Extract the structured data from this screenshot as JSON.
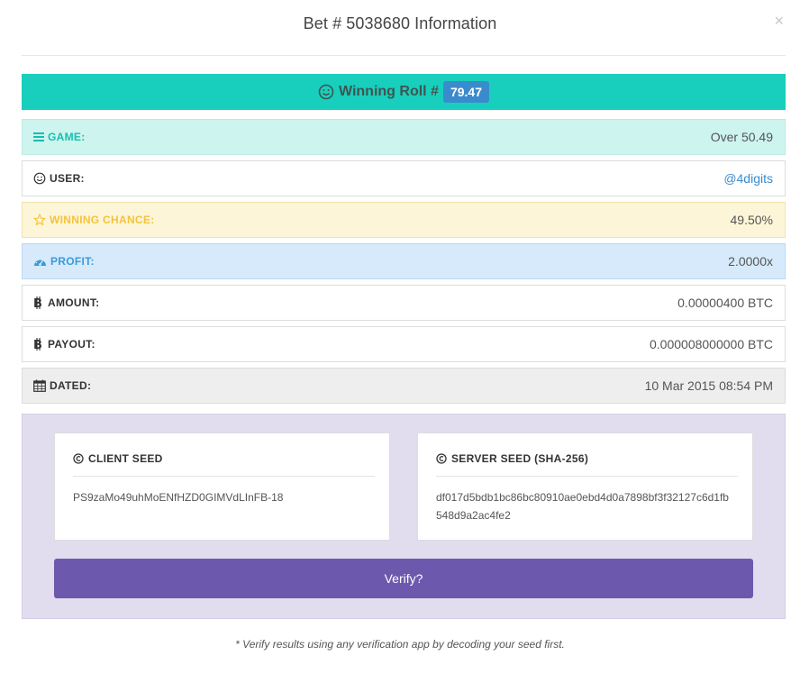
{
  "modal": {
    "title": "Bet # 5038680 Information",
    "close_label": "×"
  },
  "banner": {
    "label": "Winning Roll #",
    "roll": "79.47",
    "icon": "smile-icon"
  },
  "rows": {
    "game": {
      "label": "GAME:",
      "value": "Over 50.49",
      "icon": "bars-icon"
    },
    "user": {
      "label": "USER:",
      "value": "@4digits",
      "icon": "smile-icon"
    },
    "chance": {
      "label": "WINNING CHANCE:",
      "value": "49.50%",
      "icon": "star-icon"
    },
    "profit": {
      "label": "PROFIT:",
      "value": "2.0000x",
      "icon": "dashboard-icon"
    },
    "amount": {
      "label": "AMOUNT:",
      "value": "0.00000400 BTC",
      "icon": "bitcoin-icon"
    },
    "payout": {
      "label": "PAYOUT:",
      "value": "0.000008000000 BTC",
      "icon": "bitcoin-icon"
    },
    "dated": {
      "label": "DATED:",
      "value": "10 Mar 2015 08:54 PM",
      "icon": "calendar-icon"
    }
  },
  "seeds": {
    "client": {
      "heading": "CLIENT SEED",
      "value": "PS9zaMo49uhMoENfHZD0GIMVdLInFB-18"
    },
    "server": {
      "heading": "SERVER SEED (SHA-256)",
      "value": "df017d5bdb1bc86bc80910ae0ebd4d0a7898bf3f32127c6d1fb548d9a2ac4fe2"
    }
  },
  "verify_label": "Verify?",
  "footnote": "* Verify results using any verification app by decoding your seed first.",
  "colors": {
    "teal": "#18cfbd",
    "blue_badge": "#3a8bcd",
    "purple_button": "#6c59ad",
    "seed_panel": "#e1ddee"
  }
}
